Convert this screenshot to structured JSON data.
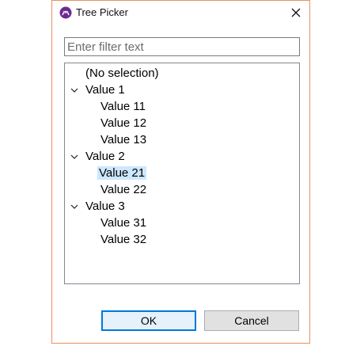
{
  "window": {
    "title": "Tree Picker",
    "accent_color": "#e7925f",
    "app_icon": "tree-picker-app-icon"
  },
  "filter": {
    "value": "",
    "placeholder": "Enter filter text"
  },
  "tree": {
    "none_label": "(No selection)",
    "groups": [
      {
        "label": "Value 1",
        "expanded": true,
        "children": [
          "Value 11",
          "Value 12",
          "Value 13"
        ]
      },
      {
        "label": "Value 2",
        "expanded": true,
        "children": [
          "Value 21",
          "Value 22"
        ]
      },
      {
        "label": "Value 3",
        "expanded": true,
        "children": [
          "Value 31",
          "Value 32"
        ]
      }
    ],
    "selected": "Value 21",
    "selection_color": "#cce8ff"
  },
  "buttons": {
    "ok_label": "OK",
    "cancel_label": "Cancel"
  }
}
